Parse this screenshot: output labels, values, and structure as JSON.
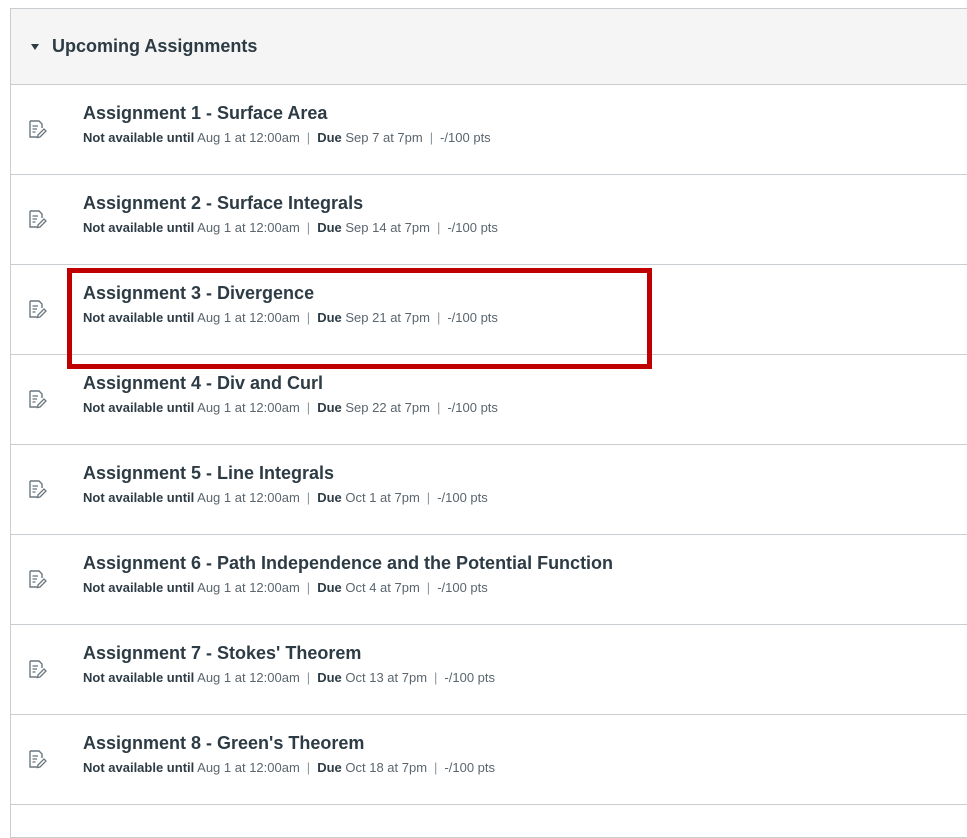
{
  "group": {
    "title": "Upcoming Assignments"
  },
  "labels": {
    "not_available": "Not available until",
    "due": "Due",
    "separator": "|"
  },
  "assignments": [
    {
      "title": "Assignment 1 - Surface Area",
      "available": "Aug 1 at 12:00am",
      "due": "Sep 7 at 7pm",
      "points": "-/100 pts"
    },
    {
      "title": "Assignment 2 - Surface Integrals",
      "available": "Aug 1 at 12:00am",
      "due": "Sep 14 at 7pm",
      "points": "-/100 pts"
    },
    {
      "title": "Assignment 3 - Divergence",
      "available": "Aug 1 at 12:00am",
      "due": "Sep 21 at 7pm",
      "points": "-/100 pts"
    },
    {
      "title": "Assignment 4 - Div and Curl",
      "available": "Aug 1 at 12:00am",
      "due": "Sep 22 at 7pm",
      "points": "-/100 pts"
    },
    {
      "title": "Assignment 5 - Line Integrals",
      "available": "Aug 1 at 12:00am",
      "due": "Oct 1 at 7pm",
      "points": "-/100 pts"
    },
    {
      "title": "Assignment 6 - Path Independence and the Potential Function",
      "available": "Aug 1 at 12:00am",
      "due": "Oct 4 at 7pm",
      "points": "-/100 pts"
    },
    {
      "title": "Assignment 7 - Stokes' Theorem",
      "available": "Aug 1 at 12:00am",
      "due": "Oct 13 at 7pm",
      "points": "-/100 pts"
    },
    {
      "title": "Assignment 8 - Green's Theorem",
      "available": "Aug 1 at 12:00am",
      "due": "Oct 18 at 7pm",
      "points": "-/100 pts"
    }
  ],
  "highlighted_index": 2,
  "colors": {
    "highlight": "#c00000",
    "text": "#2d3b45",
    "header_bg": "#f5f5f5",
    "border": "#c7cdd1"
  },
  "icons": {
    "assignment": "assignment-icon",
    "collapse": "caret-down-icon"
  }
}
